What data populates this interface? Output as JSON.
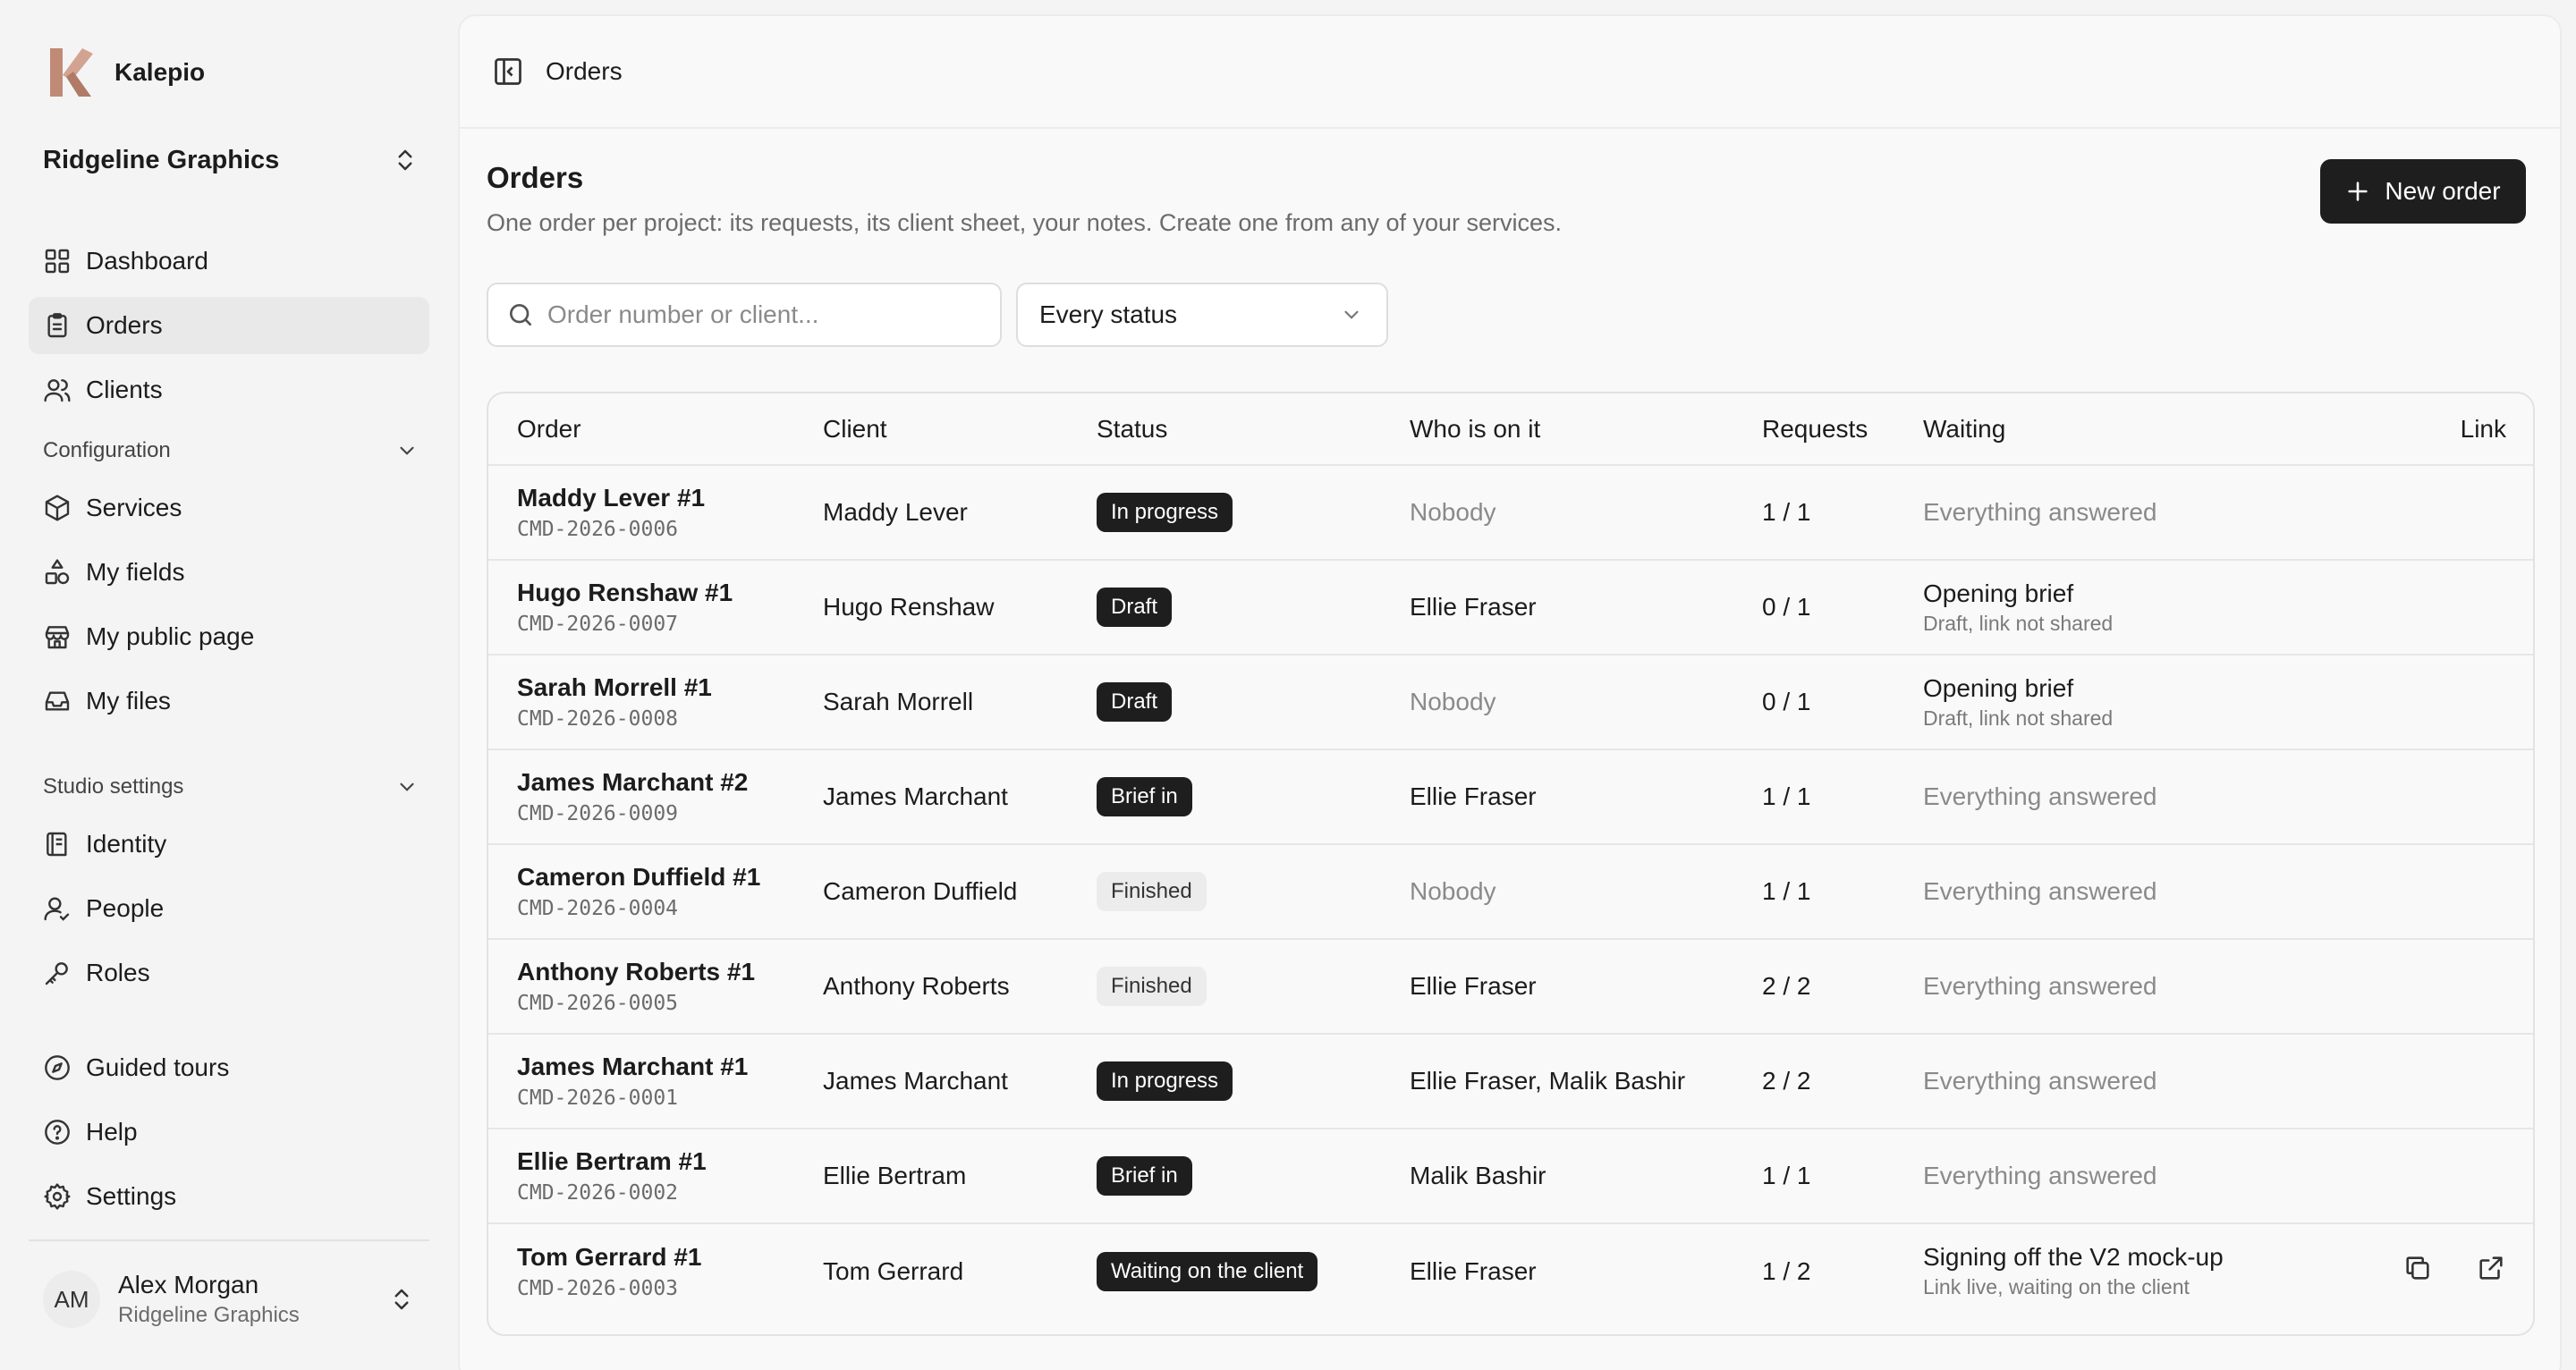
{
  "app": {
    "name": "Kalepio",
    "brand_color": "#c08a76"
  },
  "workspace": {
    "name": "Ridgeline Graphics"
  },
  "nav_main": [
    {
      "label": "Dashboard",
      "icon": "dashboard-icon",
      "active": false
    },
    {
      "label": "Orders",
      "icon": "orders-icon",
      "active": true
    },
    {
      "label": "Clients",
      "icon": "clients-icon",
      "active": false
    }
  ],
  "config": {
    "title": "Configuration",
    "items": [
      {
        "label": "Services",
        "icon": "box-icon"
      },
      {
        "label": "My fields",
        "icon": "shapes-icon"
      },
      {
        "label": "My public page",
        "icon": "store-icon"
      },
      {
        "label": "My files",
        "icon": "inbox-icon"
      }
    ]
  },
  "studio": {
    "title": "Studio settings",
    "items": [
      {
        "label": "Identity",
        "icon": "id-icon"
      },
      {
        "label": "People",
        "icon": "people-icon"
      },
      {
        "label": "Roles",
        "icon": "key-icon"
      }
    ]
  },
  "nav_bottom": [
    {
      "label": "Guided tours",
      "icon": "compass-icon"
    },
    {
      "label": "Help",
      "icon": "help-icon"
    },
    {
      "label": "Settings",
      "icon": "gear-icon"
    }
  ],
  "user": {
    "initials": "AM",
    "name": "Alex Morgan",
    "org": "Ridgeline Graphics"
  },
  "breadcrumb": "Orders",
  "page": {
    "title": "Orders",
    "subtitle": "One order per project: its requests, its client sheet, your notes. Create one from any of your services.",
    "new_button": "New order"
  },
  "filters": {
    "search_placeholder": "Order number or client...",
    "status_value": "Every status"
  },
  "table": {
    "columns": [
      "Order",
      "Client",
      "Status",
      "Who is on it",
      "Requests",
      "Waiting",
      "Link"
    ],
    "rows": [
      {
        "name": "Maddy Lever #1",
        "code": "CMD-2026-0006",
        "client": "Maddy Lever",
        "status": "In progress",
        "status_style": "dark",
        "who": "Nobody",
        "who_muted": true,
        "requests": "1 / 1",
        "waiting": "Everything answered",
        "waiting_sub": "",
        "waiting_done": true,
        "link": false
      },
      {
        "name": "Hugo Renshaw #1",
        "code": "CMD-2026-0007",
        "client": "Hugo Renshaw",
        "status": "Draft",
        "status_style": "dark",
        "who": "Ellie Fraser",
        "who_muted": false,
        "requests": "0 / 1",
        "waiting": "Opening brief",
        "waiting_sub": "Draft, link not shared",
        "waiting_done": false,
        "link": false
      },
      {
        "name": "Sarah Morrell #1",
        "code": "CMD-2026-0008",
        "client": "Sarah Morrell",
        "status": "Draft",
        "status_style": "dark",
        "who": "Nobody",
        "who_muted": true,
        "requests": "0 / 1",
        "waiting": "Opening brief",
        "waiting_sub": "Draft, link not shared",
        "waiting_done": false,
        "link": false
      },
      {
        "name": "James Marchant #2",
        "code": "CMD-2026-0009",
        "client": "James Marchant",
        "status": "Brief in",
        "status_style": "dark",
        "who": "Ellie Fraser",
        "who_muted": false,
        "requests": "1 / 1",
        "waiting": "Everything answered",
        "waiting_sub": "",
        "waiting_done": true,
        "link": false
      },
      {
        "name": "Cameron Duffield #1",
        "code": "CMD-2026-0004",
        "client": "Cameron Duffield",
        "status": "Finished",
        "status_style": "light",
        "who": "Nobody",
        "who_muted": true,
        "requests": "1 / 1",
        "waiting": "Everything answered",
        "waiting_sub": "",
        "waiting_done": true,
        "link": false
      },
      {
        "name": "Anthony Roberts #1",
        "code": "CMD-2026-0005",
        "client": "Anthony Roberts",
        "status": "Finished",
        "status_style": "light",
        "who": "Ellie Fraser",
        "who_muted": false,
        "requests": "2 / 2",
        "waiting": "Everything answered",
        "waiting_sub": "",
        "waiting_done": true,
        "link": false
      },
      {
        "name": "James Marchant #1",
        "code": "CMD-2026-0001",
        "client": "James Marchant",
        "status": "In progress",
        "status_style": "dark",
        "who": "Ellie Fraser, Malik Bashir",
        "who_muted": false,
        "requests": "2 / 2",
        "waiting": "Everything answered",
        "waiting_sub": "",
        "waiting_done": true,
        "link": false
      },
      {
        "name": "Ellie Bertram #1",
        "code": "CMD-2026-0002",
        "client": "Ellie Bertram",
        "status": "Brief in",
        "status_style": "dark",
        "who": "Malik Bashir",
        "who_muted": false,
        "requests": "1 / 1",
        "waiting": "Everything answered",
        "waiting_sub": "",
        "waiting_done": true,
        "link": false
      },
      {
        "name": "Tom Gerrard #1",
        "code": "CMD-2026-0003",
        "client": "Tom Gerrard",
        "status": "Waiting on the client",
        "status_style": "dark",
        "who": "Ellie Fraser",
        "who_muted": false,
        "requests": "1 / 2",
        "waiting": "Signing off the V2 mock-up",
        "waiting_sub": "Link live, waiting on the client",
        "waiting_done": false,
        "link": true
      }
    ]
  }
}
